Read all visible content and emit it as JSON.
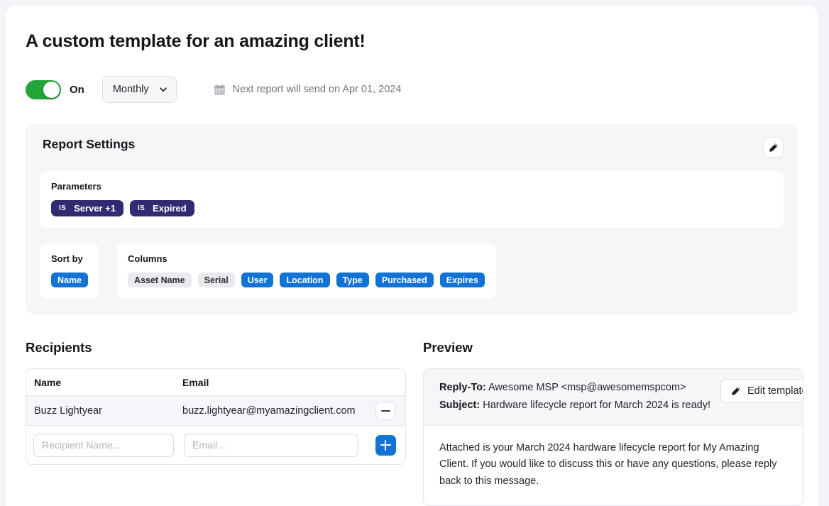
{
  "header": {
    "title": "A custom template for an amazing client!",
    "toggle_state_label": "On",
    "toggle_on": true,
    "frequency": "Monthly",
    "frequency_options": [
      "Monthly"
    ],
    "next_send_text": "Next report will send on Apr 01, 2024",
    "calendar_icon": "calendar-icon",
    "chevron_icon": "chevron-down-icon"
  },
  "report_settings": {
    "title": "Report Settings",
    "edit_icon": "pencil-icon",
    "parameters": {
      "label": "Parameters",
      "chips": [
        {
          "operator": "IS",
          "value": "Server  +1"
        },
        {
          "operator": "IS",
          "value": "Expired"
        }
      ]
    },
    "sort_by": {
      "label": "Sort by",
      "tags": [
        {
          "label": "Name",
          "active": true
        }
      ]
    },
    "columns": {
      "label": "Columns",
      "tags": [
        {
          "label": "Asset Name",
          "active": false
        },
        {
          "label": "Serial",
          "active": false
        },
        {
          "label": "User",
          "active": true
        },
        {
          "label": "Location",
          "active": true
        },
        {
          "label": "Type",
          "active": true
        },
        {
          "label": "Purchased",
          "active": true
        },
        {
          "label": "Expires",
          "active": true
        }
      ]
    }
  },
  "recipients": {
    "title": "Recipients",
    "columns": [
      "Name",
      "Email"
    ],
    "rows": [
      {
        "name": "Buzz Lightyear",
        "email": "buzz.lightyear@myamazingclient.com",
        "remove_icon": "minus-icon"
      }
    ],
    "new_row": {
      "name_value": "",
      "name_placeholder": "Recipient Name...",
      "email_value": "",
      "email_placeholder": "Email...",
      "add_icon": "plus-icon"
    }
  },
  "preview": {
    "title": "Preview",
    "reply_to_label": "Reply-To:",
    "reply_to_value": "Awesome MSP <msp@awesomemspcom>",
    "subject_label": "Subject:",
    "subject_value": "Hardware lifecycle report for March 2024 is ready!",
    "edit_template_label": "Edit template",
    "edit_template_icon": "pencil-icon",
    "body": "Attached is your March 2024 hardware lifecycle report for My Amazing Client. If you would like to discuss this or have any questions, please reply back to this message."
  },
  "colors": {
    "accent_blue": "#1273d4",
    "param_indigo": "#312b72",
    "toggle_green": "#23a437",
    "page_bg": "#f4f4f8"
  }
}
